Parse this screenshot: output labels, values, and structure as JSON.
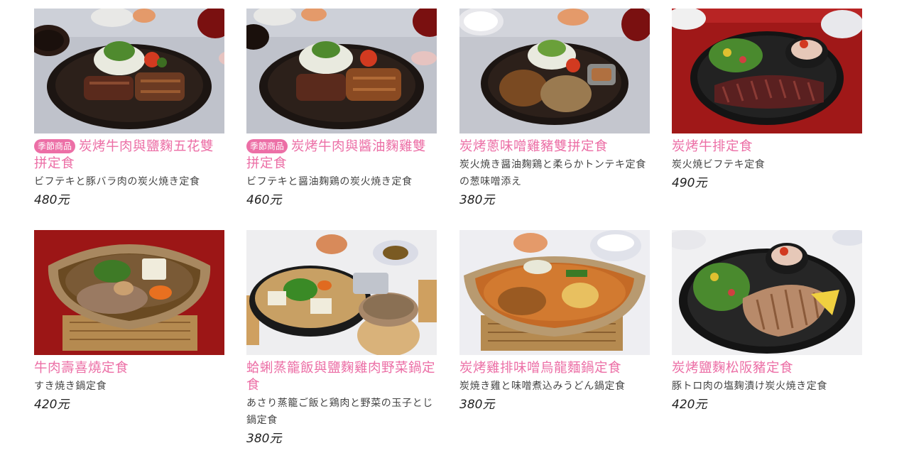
{
  "menu_items": [
    {
      "badge": "季節商品",
      "title": "炭烤牛肉與鹽麴五花雙拼定食",
      "subtitle": "ビフテキと豚バラ肉の炭火焼き定食",
      "price": "480元",
      "photo": "beef-steak-pork-belly-plate"
    },
    {
      "badge": "季節商品",
      "title": "炭烤牛肉與醬油麴雞雙拼定食",
      "subtitle": "ビフテキと醤油麹鶏の炭火焼き定食",
      "price": "460元",
      "photo": "beef-steak-chicken-plate"
    },
    {
      "badge": "",
      "title": "炭烤蔥味噌雞豬雙拼定食",
      "subtitle": "炭火焼き醤油麹鶏と柔らかトンテキ定食の葱味噌添え",
      "price": "380元",
      "photo": "chicken-pork-plate-with-sauce"
    },
    {
      "badge": "",
      "title": "炭烤牛排定食",
      "subtitle": "炭火焼ビフテキ定食",
      "price": "490元",
      "photo": "sliced-beef-steak-plate"
    },
    {
      "badge": "",
      "title": "牛肉壽喜燒定食",
      "subtitle": "すき焼き鍋定食",
      "price": "420元",
      "photo": "sukiyaki-clay-pot"
    },
    {
      "badge": "",
      "title": "蛤蜊蒸籠飯與鹽麴雞肉野菜鍋定食",
      "subtitle": "あさり蒸籠ご飯と鶏肉と野菜の玉子とじ鍋定食",
      "price": "380元",
      "photo": "clam-rice-chicken-hot-pot"
    },
    {
      "badge": "",
      "title": "炭烤雞排味噌烏龍麵鍋定食",
      "subtitle": "炭焼き雞と味噌煮込みうどん鍋定食",
      "price": "380元",
      "photo": "miso-udon-clay-pot"
    },
    {
      "badge": "",
      "title": "炭烤鹽麴松阪豬定食",
      "subtitle": "豚トロ肉の塩麹漬け炭火焼き定食",
      "price": "420元",
      "photo": "pork-jowl-salad-plate"
    }
  ],
  "colors": {
    "accent_pink": "#ec6fa6",
    "text_dark": "#444444"
  }
}
